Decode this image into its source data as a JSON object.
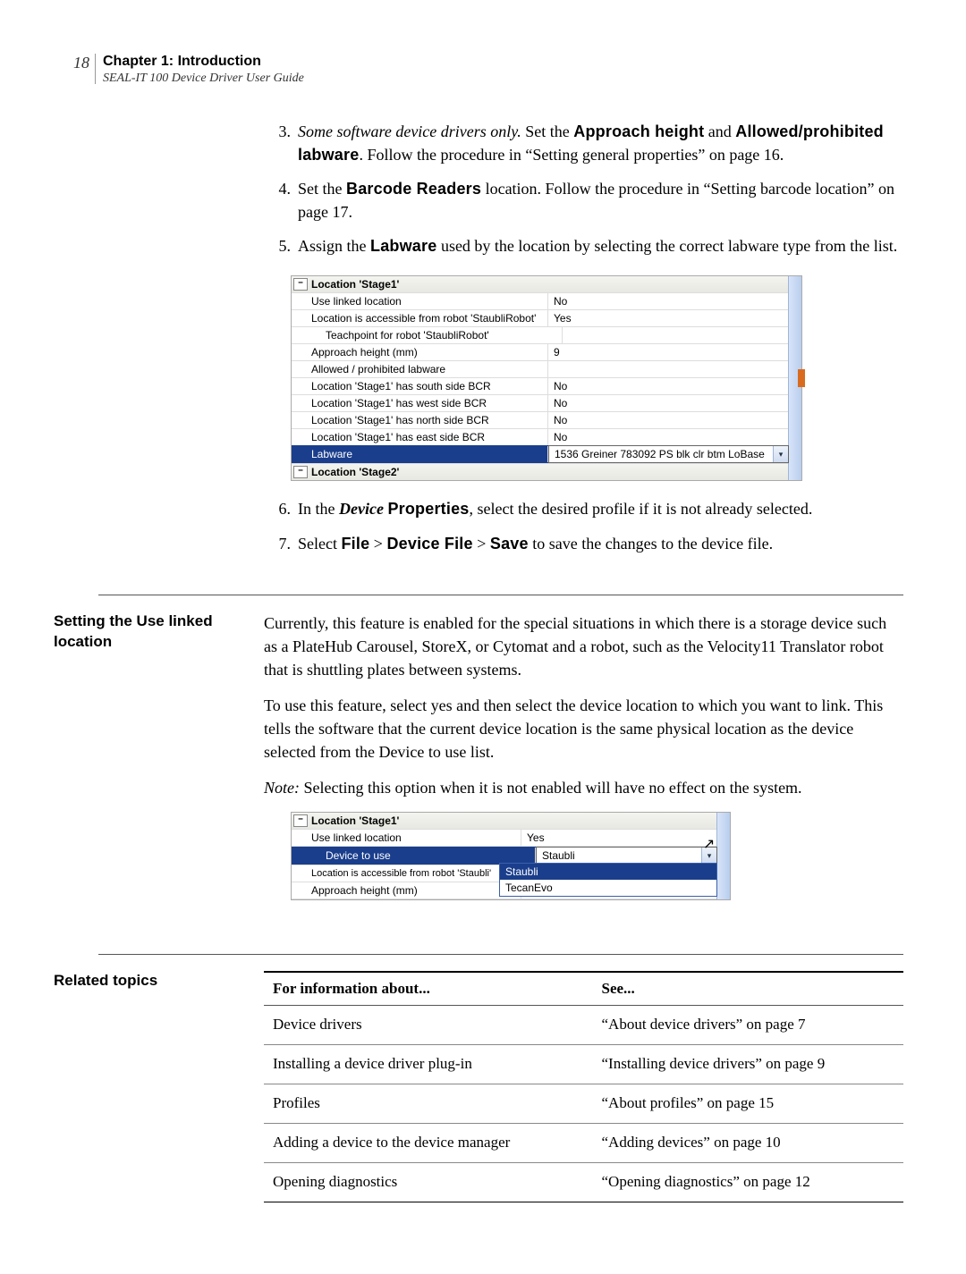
{
  "header": {
    "page_number": "18",
    "chapter": "Chapter 1: Introduction",
    "guide": "SEAL-IT 100 Device Driver User Guide"
  },
  "steps": {
    "s3": {
      "num": "3.",
      "lead_italic": "Some software device drivers only.",
      "t1": " Set the ",
      "b1": "Approach height",
      "t2": " and ",
      "b2": "Allowed/prohibited labware",
      "t3": ". Follow the procedure in “Setting general properties” on page 16."
    },
    "s4": {
      "num": "4.",
      "t1": "Set the ",
      "b1": "Barcode Readers",
      "t2": " location. Follow the procedure in “Setting barcode location” on page 17."
    },
    "s5": {
      "num": "5.",
      "t1": "Assign the ",
      "b1": "Labware",
      "t2": " used by the location by selecting the correct labware type from the list."
    },
    "s6": {
      "num": "6.",
      "t1": "In the ",
      "bi": "Device",
      "sp": " ",
      "b1": "Properties",
      "t2": ", select the desired profile if it is not already selected."
    },
    "s7": {
      "num": "7.",
      "t1": "Select ",
      "b1": "File",
      "gt1": " > ",
      "b2": "Device File",
      "gt2": " > ",
      "b3": "Save",
      "t2": " to save the changes to the device file."
    }
  },
  "propgrid1": {
    "head1": "Location 'Stage1'",
    "rows": [
      {
        "label": "Use linked location",
        "val": "No"
      },
      {
        "label": "Location is accessible from robot 'StaubliRobot'",
        "val": "Yes"
      },
      {
        "label": "Teachpoint for robot 'StaubliRobot'",
        "val": "",
        "indent": 2
      },
      {
        "label": "Approach height (mm)",
        "val": "9"
      },
      {
        "label": "Allowed / prohibited labware",
        "val": ""
      },
      {
        "label": "Location 'Stage1' has south side BCR",
        "val": "No"
      },
      {
        "label": "Location 'Stage1' has west side BCR",
        "val": "No"
      },
      {
        "label": "Location 'Stage1' has north side BCR",
        "val": "No"
      },
      {
        "label": "Location 'Stage1' has east side BCR",
        "val": "No"
      }
    ],
    "selected": {
      "label": "Labware",
      "val": "1536 Greiner 783092 PS blk clr btm LoBase"
    },
    "head2": "Location 'Stage2'"
  },
  "section2": {
    "heading": "Setting the Use linked location",
    "p1": "Currently, this feature is enabled for the special situations in which there is a storage device such as a PlateHub Carousel, StoreX, or Cytomat and a robot, such as the Velocity11 Translator robot that is shuttling plates between systems.",
    "p2": "To use this feature, select yes and then select the device location to which you want to link. This tells the software that the current device location is the same physical location as the device selected from the Device to use list.",
    "note_label": "Note:",
    "note_body": " Selecting this option when it is not enabled will have no effect on the system."
  },
  "propgrid2": {
    "head1": "Location 'Stage1'",
    "row1": {
      "label": "Use linked location",
      "val": "Yes"
    },
    "selected": {
      "label": "Device to use",
      "val": "Staubli"
    },
    "row3": {
      "label": "Location is accessible from robot 'Staubli'",
      "val": ""
    },
    "row4": {
      "label": "Approach height (mm)",
      "val": ""
    },
    "options": [
      "Staubli",
      "TecanEvo"
    ]
  },
  "related": {
    "heading": "Related topics",
    "th1": "For information about...",
    "th2": "See...",
    "rows": [
      {
        "a": "Device drivers",
        "b": "“About device drivers” on page 7"
      },
      {
        "a": "Installing a device driver plug-in",
        "b": "“Installing device drivers” on page 9"
      },
      {
        "a": "Profiles",
        "b": "“About profiles” on page 15"
      },
      {
        "a": "Adding a device to the device manager",
        "b": "“Adding devices” on page 10"
      },
      {
        "a": "Opening diagnostics",
        "b": "“Opening diagnostics” on page 12"
      }
    ]
  },
  "glyph": {
    "minus": "–",
    "down": "▾",
    "cursor": "↖"
  }
}
